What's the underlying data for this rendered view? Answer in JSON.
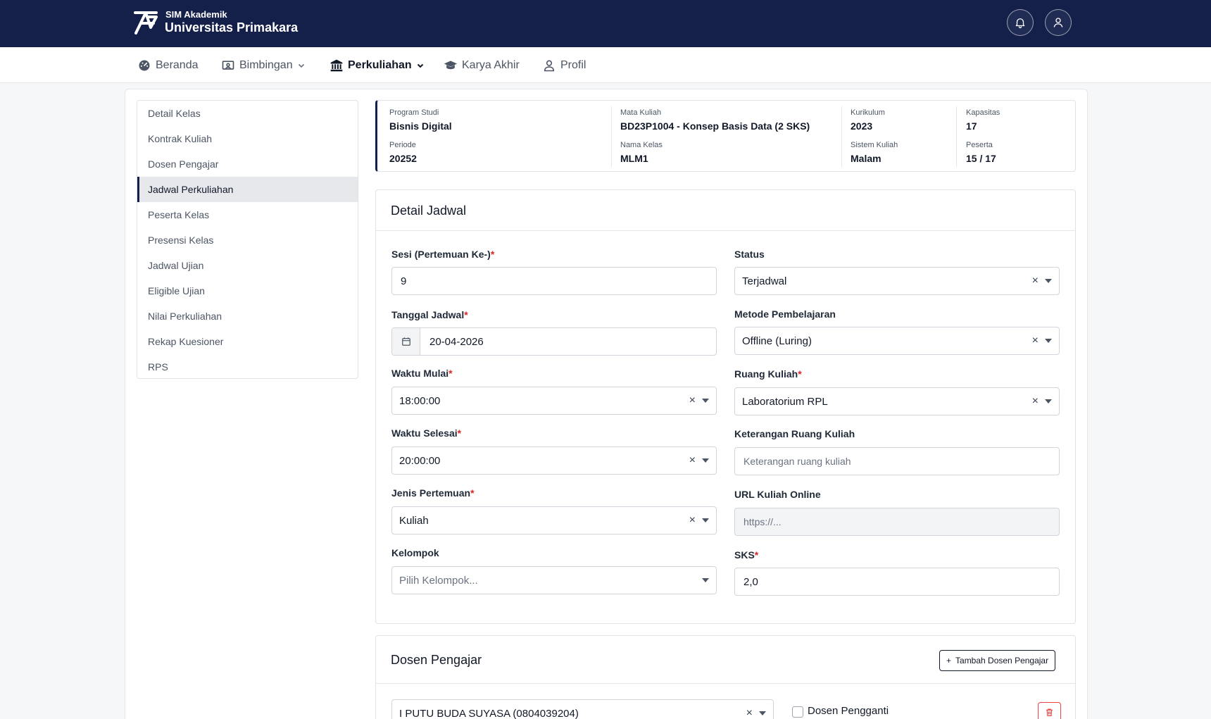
{
  "header": {
    "brand_small": "SIM Akademik",
    "brand_name": "Universitas Primakara",
    "bell_icon": "bell-icon",
    "user_icon": "user-icon"
  },
  "nav": {
    "items": [
      {
        "label": "Beranda",
        "icon": "dashboard-icon"
      },
      {
        "label": "Bimbingan",
        "icon": "presentation-icon",
        "dropdown": true
      },
      {
        "label": "Perkuliahan",
        "icon": "bank-icon",
        "dropdown": true,
        "active": true
      },
      {
        "label": "Karya Akhir",
        "icon": "graduation-cap-icon"
      },
      {
        "label": "Profil",
        "icon": "user-icon"
      }
    ]
  },
  "sidebar": {
    "items": [
      {
        "label": "Detail Kelas"
      },
      {
        "label": "Kontrak Kuliah"
      },
      {
        "label": "Dosen Pengajar"
      },
      {
        "label": "Jadwal Perkuliahan",
        "active": true
      },
      {
        "label": "Peserta Kelas"
      },
      {
        "label": "Presensi Kelas"
      },
      {
        "label": "Jadwal Ujian"
      },
      {
        "label": "Eligible Ujian"
      },
      {
        "label": "Nilai Perkuliahan"
      },
      {
        "label": "Rekap Kuesioner"
      },
      {
        "label": "RPS"
      }
    ]
  },
  "info": {
    "program_studi": {
      "label": "Program Studi",
      "value": "Bisnis Digital"
    },
    "mata_kuliah": {
      "label": "Mata Kuliah",
      "value": "BD23P1004 - Konsep Basis Data (2 SKS)"
    },
    "kurikulum": {
      "label": "Kurikulum",
      "value": "2023"
    },
    "kapasitas": {
      "label": "Kapasitas",
      "value": "17"
    },
    "periode": {
      "label": "Periode",
      "value": "20252"
    },
    "nama_kelas": {
      "label": "Nama Kelas",
      "value": "MLM1"
    },
    "sistem_kuliah": {
      "label": "Sistem Kuliah",
      "value": "Malam"
    },
    "peserta": {
      "label": "Peserta",
      "value": "15 / 17"
    }
  },
  "detail_jadwal": {
    "title": "Detail Jadwal",
    "sesi": {
      "label": "Sesi (Pertemuan Ke-)",
      "value": "9"
    },
    "tanggal": {
      "label": "Tanggal Jadwal",
      "value": "20-04-2026"
    },
    "waktu_mulai": {
      "label": "Waktu Mulai",
      "value": "18:00:00"
    },
    "waktu_selesai": {
      "label": "Waktu Selesai",
      "value": "20:00:00"
    },
    "jenis_pertemuan": {
      "label": "Jenis Pertemuan",
      "value": "Kuliah"
    },
    "kelompok": {
      "label": "Kelompok",
      "placeholder": "Pilih Kelompok..."
    },
    "status": {
      "label": "Status",
      "value": "Terjadwal"
    },
    "metode": {
      "label": "Metode Pembelajaran",
      "value": "Offline (Luring)"
    },
    "ruang": {
      "label": "Ruang Kuliah",
      "value": "Laboratorium RPL"
    },
    "keterangan_ruang": {
      "label": "Keterangan Ruang Kuliah",
      "placeholder": "Keterangan ruang kuliah"
    },
    "url_online": {
      "label": "URL Kuliah Online",
      "placeholder": "https://..."
    },
    "sks": {
      "label": "SKS",
      "value": "2,0"
    },
    "required_mark": "*",
    "clear_symbol": "×"
  },
  "dosen_pengajar": {
    "title": "Dosen Pengajar",
    "add_button": "Tambah Dosen Pengajar",
    "plus": "+",
    "dosen_value": "I PUTU BUDA SUYASA (0804039204)",
    "pengganti_label": "Dosen Pengganti"
  },
  "colors": {
    "navy": "#141f4a",
    "danger": "#dc2626"
  }
}
